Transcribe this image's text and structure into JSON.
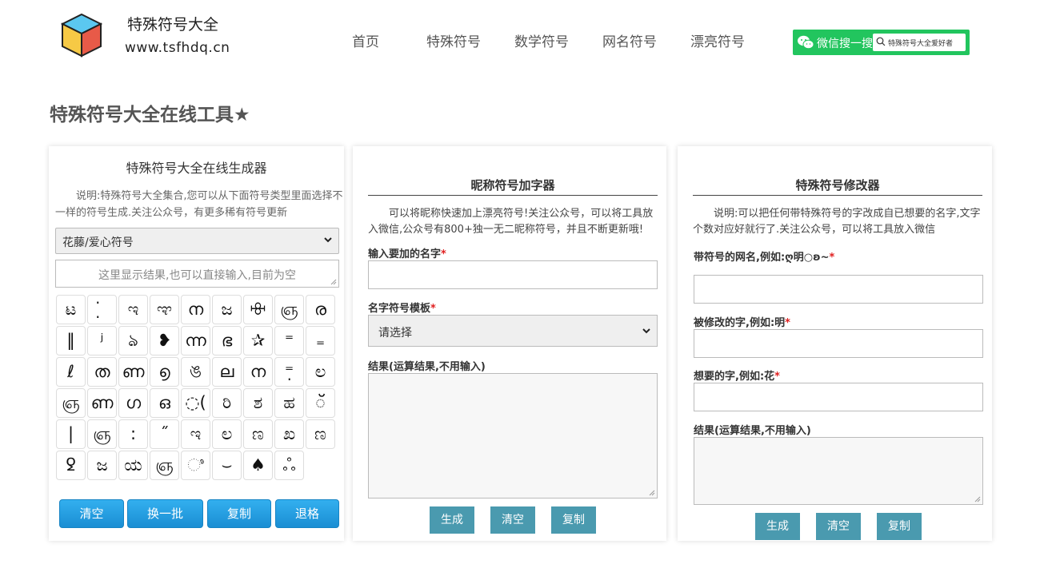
{
  "header": {
    "site_name": "特殊符号大全",
    "site_url": "www.tsfhdq.cn",
    "nav": [
      "首页",
      "特殊符号",
      "数学符号",
      "网名符号",
      "漂亮符号"
    ],
    "wechat_label": "微信搜一搜",
    "wechat_search_text": "特殊符号大全爱好者",
    "wechat_color": "#22c55e"
  },
  "page_title": "特殊符号大全在线工具★",
  "generator": {
    "title": "特殊符号大全在线生成器",
    "description": "说明:特殊符号大全集合,您可以从下面符号类型里面选择不一样的符号生成.关注公众号，有更多稀有符号更新",
    "category_selected": "花藤/爱心符号",
    "result_placeholder": "这里显示结果,也可以直接输入,目前为空",
    "symbols": [
      "ಟ",
      "̣̇",
      "ಇ",
      "ಞ",
      "ന",
      "ಜ",
      "ꗳ",
      "ஞ",
      "ര",
      "‖",
      "ʲ",
      "ঌ",
      "❥",
      "ന്ന",
      "ഭ",
      "✰",
      "⁼",
      "₌",
      "ℓ",
      "ത",
      "ണ",
      "൭",
      "ঙ",
      "ല",
      "ന",
      "⁼̣",
      "ಲ",
      "ஞ",
      "ണ",
      "ഗ",
      "ഒ",
      "◌(",
      "ರಿ",
      "ಶ",
      "ಹ",
      "ॅ",
      "|",
      "ஞ",
      "꞉",
      "˝",
      "ಇ",
      "ಲ",
      "ಣ",
      "ಖ",
      "ಣ",
      "ꝿ",
      "ಜ",
      "ಯ",
      "ஞ",
      "ಿ",
      "⌣",
      "♠",
      "ஃ"
    ],
    "buttons": [
      "清空",
      "换一批",
      "复制",
      "退格"
    ]
  },
  "nickname": {
    "title": "昵称符号加字器",
    "description": "可以将昵称快速加上漂亮符号!关注公众号，可以将工具放入微信,公众号有800+独一无二昵称符号，并且不断更新哦!",
    "name_label": "输入要加的名字",
    "template_label": "名字符号模板",
    "template_selected": "请选择",
    "result_label": "结果(运算结果,不用输入)",
    "buttons": [
      "生成",
      "清空",
      "复制"
    ]
  },
  "modifier": {
    "title": "特殊符号修改器",
    "description": "说明:可以把任何带特殊符号的字改成自已想要的名字,文字个数对应好就行了.关注公众号，可以将工具放入微信",
    "field1_label": "带符号的网名,例如:ღ明○ʚ~",
    "field2_label": "被修改的字,例如:明",
    "field3_label": "想要的字,例如:花",
    "result_label": "结果(运算结果,不用输入)",
    "buttons": [
      "生成",
      "清空",
      "复制"
    ]
  },
  "colors": {
    "blue_button": "#1a8ed3",
    "teal_button": "#4a9aaf",
    "required_star": "#e02020"
  },
  "required_mark": "*"
}
